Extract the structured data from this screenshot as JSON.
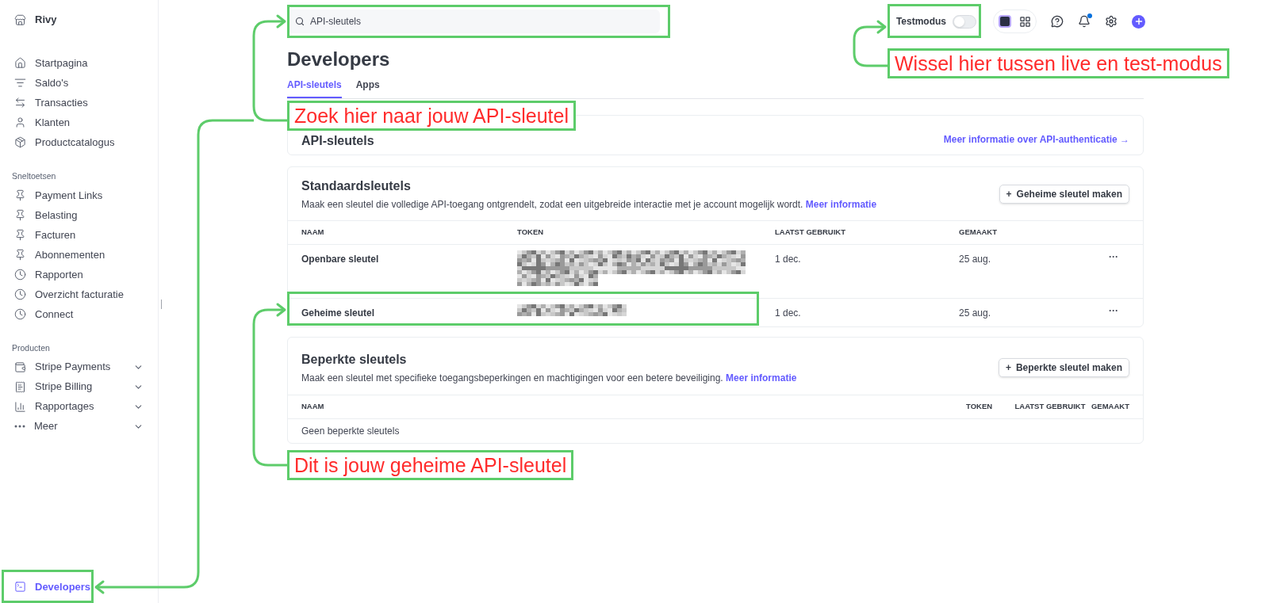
{
  "sidebar": {
    "account": "Rivy",
    "main_items": [
      {
        "label": "Startpagina",
        "selected": false
      },
      {
        "label": "Saldo's",
        "selected": false
      },
      {
        "label": "Transacties",
        "selected": false
      },
      {
        "label": "Klanten",
        "selected": false
      },
      {
        "label": "Productcatalogus",
        "selected": false
      }
    ],
    "shortcuts_heading": "Sneltoetsen",
    "shortcuts": [
      {
        "label": "Payment Links",
        "kind": "pin"
      },
      {
        "label": "Belasting",
        "kind": "pin"
      },
      {
        "label": "Facturen",
        "kind": "pin"
      },
      {
        "label": "Abonnementen",
        "kind": "pin"
      },
      {
        "label": "Rapporten",
        "kind": "recent"
      },
      {
        "label": "Overzicht facturatie",
        "kind": "recent"
      },
      {
        "label": "Connect",
        "kind": "recent"
      }
    ],
    "products_heading": "Producten",
    "products": [
      {
        "label": "Stripe Payments",
        "expanded": false
      },
      {
        "label": "Stripe Billing",
        "expanded": false
      },
      {
        "label": "Rapportages",
        "expanded": false
      },
      {
        "label": "Meer",
        "expanded": false
      }
    ],
    "footer_item": {
      "label": "Developers",
      "selected": true
    }
  },
  "search": {
    "value": "API-sleutels"
  },
  "topbar": {
    "test_mode": {
      "label": "Testmodus",
      "on": false
    }
  },
  "page": {
    "title": "Developers",
    "tabs": [
      {
        "label": "API-sleutels",
        "selected": true
      },
      {
        "label": "Apps",
        "selected": false
      }
    ],
    "api_card": {
      "title": "API-sleutels",
      "link": "Meer informatie over API-authenticatie →"
    },
    "standard_keys": {
      "title": "Standaardsleutels",
      "description": "Maak een sleutel die volledige API-toegang ontgrendelt, zodat een uitgebreide interactie met je account mogelijk wordt.",
      "link": "Meer informatie",
      "button_icon": "+",
      "button": "Geheime sleutel maken",
      "columns": [
        "NAAM",
        "TOKEN",
        "LAATST GEBRUIKT",
        "GEMAAKT"
      ],
      "rows": [
        {
          "name": "Openbare sleutel",
          "last_used": "1 dec.",
          "created": "25 aug.",
          "menu": "···"
        },
        {
          "name": "Geheime sleutel",
          "last_used": "1 dec.",
          "created": "25 aug.",
          "menu": "···"
        }
      ]
    },
    "restricted_keys": {
      "title": "Beperkte sleutels",
      "description": "Maak een sleutel met specifieke toegangsbeperkingen en machtigingen voor een betere beveiliging.",
      "link": "Meer informatie",
      "button_icon": "+",
      "button": "Beperkte sleutel maken",
      "columns": [
        "NAAM",
        "TOKEN",
        "LAATST GEBRUIKT",
        "GEMAAKT"
      ],
      "empty": "Geen beperkte sleutels"
    }
  },
  "annotations": [
    {
      "text": "Wissel hier tussen live en test-modus"
    },
    {
      "text": "Zoek hier naar jouw API-sleutel"
    },
    {
      "text": "Dit is jouw geheime API-sleutel"
    }
  ]
}
